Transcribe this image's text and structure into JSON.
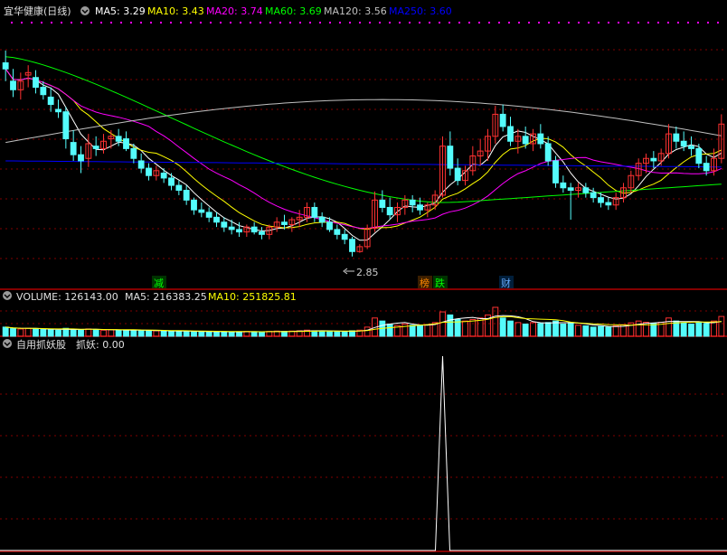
{
  "price_panel": {
    "title": "宜华健康(日线)",
    "ma_legend": [
      {
        "label": "MA5: 3.29",
        "color": "#ffffff"
      },
      {
        "label": "MA10: 3.43",
        "color": "#ffff00"
      },
      {
        "label": "MA20: 3.74",
        "color": "#ff00ff"
      },
      {
        "label": "MA60: 3.69",
        "color": "#00ff00"
      },
      {
        "label": "MA120: 3.56",
        "color": "#c0c0c0"
      },
      {
        "label": "MA250: 3.60",
        "color": "#0000ff"
      }
    ],
    "low_marker": "2.85",
    "tags": [
      {
        "text": "减",
        "bg": "#004400",
        "fg": "#00ff00"
      },
      {
        "text": "榜",
        "bg": "#442200",
        "fg": "#ff8800"
      },
      {
        "text": "跌",
        "bg": "#004400",
        "fg": "#00ff00"
      },
      {
        "text": "财",
        "bg": "#002244",
        "fg": "#66aaff"
      }
    ]
  },
  "volume_panel": {
    "title": "VOLUME: 126143.00",
    "ma5": "MA5: 216383.25",
    "ma10": "MA10: 251825.81"
  },
  "indicator_panel": {
    "title": "自用抓妖股",
    "value": "抓妖: 0.00"
  },
  "colors": {
    "up": "#ff3232",
    "down": "#54fcfc",
    "grid": "#800000",
    "border": "#b00000"
  },
  "chart_data": {
    "type": "candlestick",
    "ylim": [
      2.7,
      4.75
    ],
    "tags": [
      "减",
      "榜",
      "跌",
      "财"
    ],
    "ohlc": [
      [
        4.4,
        4.5,
        4.25,
        4.35
      ],
      [
        4.25,
        4.35,
        4.12,
        4.18
      ],
      [
        4.18,
        4.32,
        4.1,
        4.25
      ],
      [
        4.3,
        4.38,
        4.2,
        4.32
      ],
      [
        4.28,
        4.34,
        4.15,
        4.2
      ],
      [
        4.2,
        4.25,
        4.1,
        4.14
      ],
      [
        4.12,
        4.2,
        4.0,
        4.06
      ],
      [
        4.02,
        4.1,
        3.95,
        4.0
      ],
      [
        4.0,
        4.04,
        3.7,
        3.78
      ],
      [
        3.75,
        3.85,
        3.6,
        3.65
      ],
      [
        3.65,
        3.72,
        3.5,
        3.6
      ],
      [
        3.62,
        3.82,
        3.55,
        3.74
      ],
      [
        3.72,
        3.8,
        3.64,
        3.7
      ],
      [
        3.7,
        3.82,
        3.66,
        3.76
      ],
      [
        3.78,
        3.85,
        3.7,
        3.8
      ],
      [
        3.8,
        3.86,
        3.72,
        3.76
      ],
      [
        3.78,
        3.84,
        3.68,
        3.7
      ],
      [
        3.7,
        3.74,
        3.58,
        3.62
      ],
      [
        3.6,
        3.66,
        3.5,
        3.54
      ],
      [
        3.54,
        3.58,
        3.44,
        3.48
      ],
      [
        3.48,
        3.56,
        3.44,
        3.52
      ],
      [
        3.5,
        3.54,
        3.42,
        3.46
      ],
      [
        3.46,
        3.5,
        3.36,
        3.4
      ],
      [
        3.4,
        3.44,
        3.32,
        3.36
      ],
      [
        3.36,
        3.4,
        3.24,
        3.28
      ],
      [
        3.28,
        3.3,
        3.16,
        3.2
      ],
      [
        3.2,
        3.26,
        3.14,
        3.18
      ],
      [
        3.18,
        3.22,
        3.1,
        3.14
      ],
      [
        3.14,
        3.18,
        3.06,
        3.1
      ],
      [
        3.1,
        3.14,
        3.02,
        3.06
      ],
      [
        3.06,
        3.12,
        3.0,
        3.04
      ],
      [
        3.04,
        3.1,
        2.98,
        3.02
      ],
      [
        3.02,
        3.08,
        2.98,
        3.06
      ],
      [
        3.06,
        3.1,
        3.0,
        3.02
      ],
      [
        3.02,
        3.06,
        2.96,
        3.0
      ],
      [
        3.0,
        3.08,
        2.96,
        3.06
      ],
      [
        3.06,
        3.14,
        3.02,
        3.1
      ],
      [
        3.1,
        3.16,
        3.04,
        3.08
      ],
      [
        3.08,
        3.14,
        3.02,
        3.12
      ],
      [
        3.12,
        3.2,
        3.06,
        3.14
      ],
      [
        3.14,
        3.26,
        3.1,
        3.22
      ],
      [
        3.22,
        3.26,
        3.1,
        3.14
      ],
      [
        3.14,
        3.18,
        3.06,
        3.1
      ],
      [
        3.1,
        3.14,
        3.02,
        3.04
      ],
      [
        3.04,
        3.08,
        2.96,
        3.0
      ],
      [
        3.0,
        3.04,
        2.92,
        2.96
      ],
      [
        2.96,
        2.98,
        2.82,
        2.86
      ],
      [
        2.86,
        2.92,
        2.85,
        2.9
      ],
      [
        2.9,
        3.08,
        2.88,
        3.05
      ],
      [
        3.05,
        3.35,
        3.02,
        3.28
      ],
      [
        3.28,
        3.36,
        3.18,
        3.22
      ],
      [
        3.22,
        3.3,
        3.12,
        3.16
      ],
      [
        3.16,
        3.26,
        3.1,
        3.22
      ],
      [
        3.22,
        3.32,
        3.16,
        3.28
      ],
      [
        3.28,
        3.32,
        3.18,
        3.24
      ],
      [
        3.24,
        3.3,
        3.16,
        3.2
      ],
      [
        3.2,
        3.26,
        3.14,
        3.24
      ],
      [
        3.24,
        3.36,
        3.2,
        3.32
      ],
      [
        3.32,
        3.8,
        3.3,
        3.72
      ],
      [
        3.72,
        3.84,
        3.48,
        3.54
      ],
      [
        3.54,
        3.62,
        3.4,
        3.44
      ],
      [
        3.44,
        3.56,
        3.4,
        3.52
      ],
      [
        3.52,
        3.72,
        3.48,
        3.64
      ],
      [
        3.64,
        3.78,
        3.56,
        3.68
      ],
      [
        3.68,
        3.86,
        3.6,
        3.8
      ],
      [
        3.8,
        4.05,
        3.74,
        3.98
      ],
      [
        3.98,
        4.06,
        3.84,
        3.88
      ],
      [
        3.88,
        3.96,
        3.72,
        3.76
      ],
      [
        3.76,
        3.86,
        3.66,
        3.8
      ],
      [
        3.8,
        3.88,
        3.7,
        3.74
      ],
      [
        3.74,
        3.86,
        3.68,
        3.82
      ],
      [
        3.82,
        3.9,
        3.7,
        3.74
      ],
      [
        3.74,
        3.8,
        3.56,
        3.6
      ],
      [
        3.6,
        3.64,
        3.38,
        3.42
      ],
      [
        3.42,
        3.48,
        3.34,
        3.38
      ],
      [
        3.38,
        3.42,
        3.12,
        3.36
      ],
      [
        3.36,
        3.42,
        3.3,
        3.38
      ],
      [
        3.38,
        3.42,
        3.3,
        3.34
      ],
      [
        3.34,
        3.38,
        3.26,
        3.3
      ],
      [
        3.3,
        3.34,
        3.22,
        3.26
      ],
      [
        3.26,
        3.3,
        3.2,
        3.24
      ],
      [
        3.24,
        3.34,
        3.2,
        3.3
      ],
      [
        3.3,
        3.42,
        3.26,
        3.38
      ],
      [
        3.38,
        3.52,
        3.34,
        3.48
      ],
      [
        3.48,
        3.62,
        3.44,
        3.58
      ],
      [
        3.58,
        3.66,
        3.5,
        3.62
      ],
      [
        3.62,
        3.68,
        3.54,
        3.6
      ],
      [
        3.6,
        3.7,
        3.56,
        3.66
      ],
      [
        3.66,
        3.9,
        3.62,
        3.82
      ],
      [
        3.82,
        3.88,
        3.7,
        3.76
      ],
      [
        3.76,
        3.84,
        3.68,
        3.72
      ],
      [
        3.72,
        3.8,
        3.64,
        3.7
      ],
      [
        3.7,
        3.74,
        3.54,
        3.58
      ],
      [
        3.58,
        3.64,
        3.48,
        3.52
      ],
      [
        3.52,
        3.7,
        3.48,
        3.62
      ],
      [
        3.62,
        3.98,
        3.58,
        3.9
      ]
    ],
    "volume": [
      3,
      2.5,
      2.4,
      2.6,
      2.4,
      2.2,
      2.1,
      2,
      2.6,
      2.3,
      2.2,
      2.4,
      2.1,
      2,
      2.1,
      2,
      1.9,
      2,
      1.9,
      1.8,
      1.8,
      1.7,
      1.6,
      1.7,
      1.6,
      1.5,
      1.6,
      1.5,
      1.4,
      1.5,
      1.4,
      1.5,
      1.6,
      1.5,
      1.4,
      1.6,
      1.7,
      1.6,
      1.7,
      1.8,
      2,
      1.8,
      1.7,
      1.6,
      1.5,
      1.6,
      1.8,
      2,
      3,
      6,
      5,
      4,
      3.5,
      4,
      3.6,
      3.4,
      3.8,
      4.5,
      8,
      7,
      5.5,
      5,
      5.5,
      6,
      7,
      9.5,
      6,
      5,
      4.5,
      4,
      4.5,
      4.2,
      4.5,
      5,
      4,
      4.5,
      3.6,
      3.4,
      3,
      3.2,
      3,
      3.4,
      3.8,
      4.4,
      5,
      4.6,
      4.2,
      4.6,
      6,
      5,
      4.4,
      4,
      4.6,
      4.2,
      5,
      6.5
    ],
    "indicator_spike_index": 58
  }
}
